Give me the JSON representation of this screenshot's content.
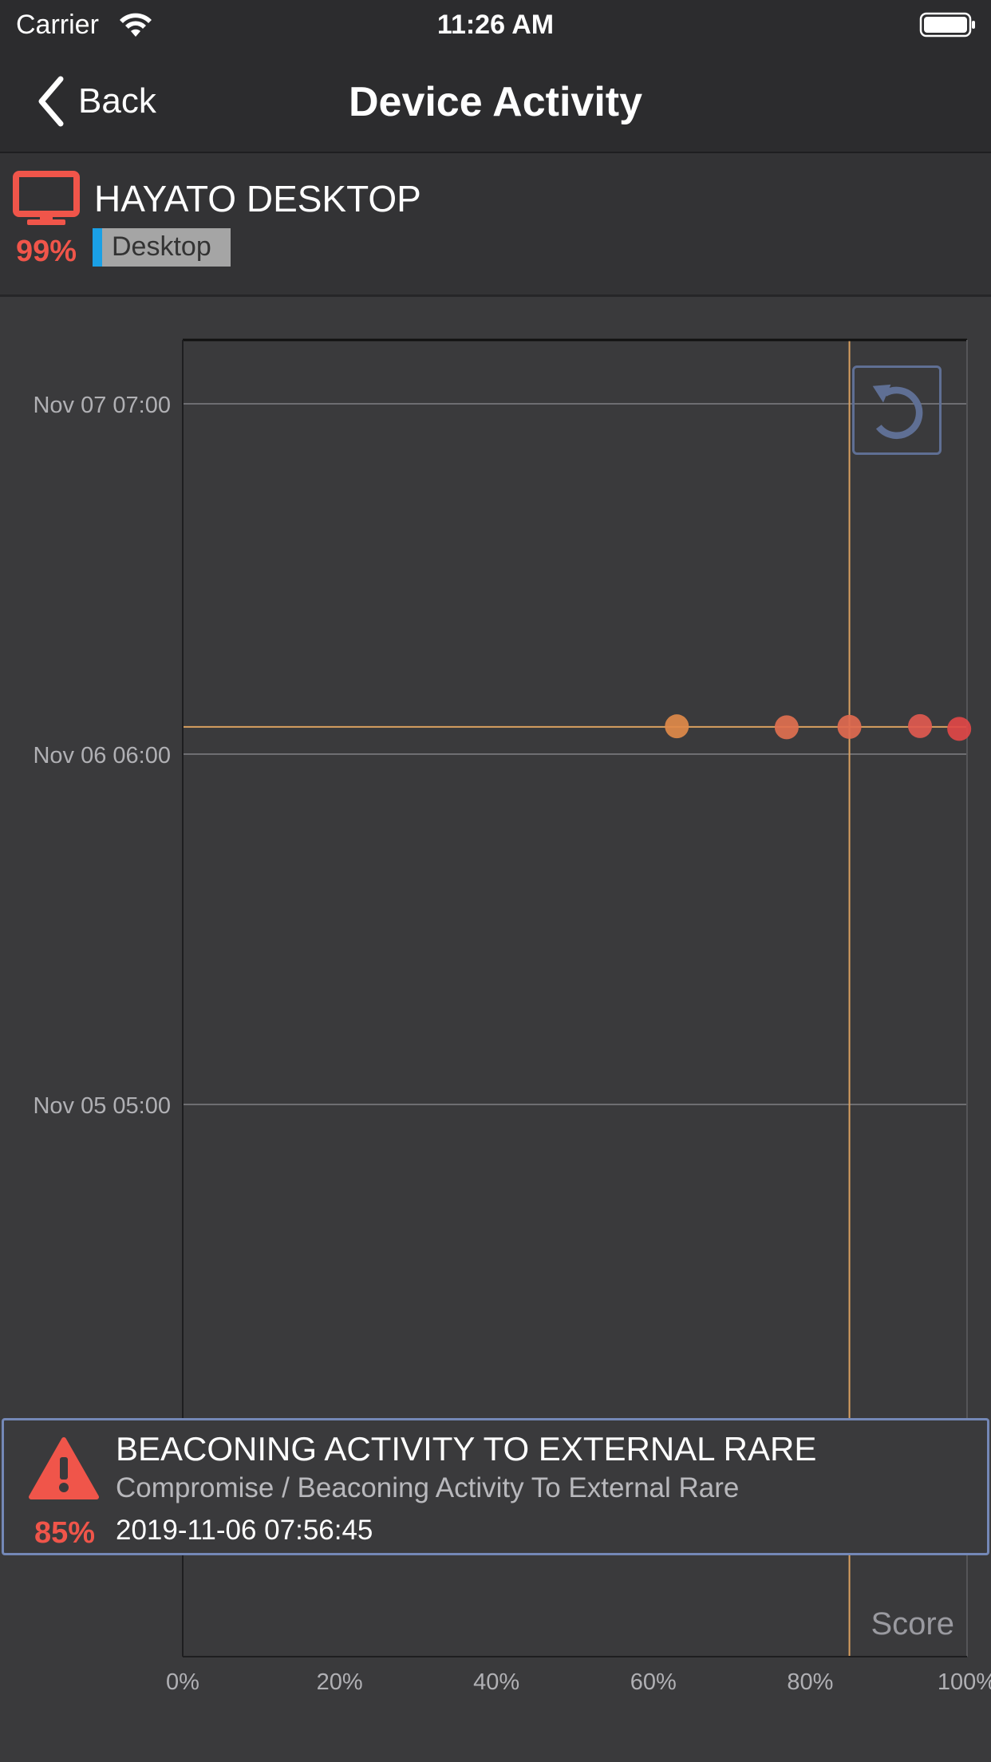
{
  "status_bar": {
    "carrier": "Carrier",
    "time": "11:26 AM"
  },
  "nav": {
    "back_label": "Back",
    "title": "Device Activity"
  },
  "device": {
    "name": "HAYATO DESKTOP",
    "score": "99%",
    "type_tag": "Desktop",
    "icon": "desktop-monitor-icon",
    "icon_color": "#f0554a",
    "tag_accent": "#1aa0e6"
  },
  "chart_data": {
    "type": "scatter",
    "xlabel": "Score",
    "x_ticks": [
      "0%",
      "20%",
      "40%",
      "60%",
      "80%",
      "100%"
    ],
    "xlim": [
      0,
      100
    ],
    "y_ticks": [
      "Nov 07 07:00",
      "Nov 06 06:00",
      "Nov 05 05:00"
    ],
    "y_axis": "time (descending)",
    "grid": true,
    "crosshair": {
      "x": 85,
      "y": "2019-11-06 07:56:45"
    },
    "points": [
      {
        "score": 63,
        "time": "2019-11-06 07:59",
        "color": "#e08a4a"
      },
      {
        "score": 77,
        "time": "2019-11-06 07:55",
        "color": "#e07050"
      },
      {
        "score": 85,
        "time": "2019-11-06 07:56:45",
        "color": "#e06a50"
      },
      {
        "score": 94,
        "time": "2019-11-06 08:00",
        "color": "#e05a50"
      },
      {
        "score": 99,
        "time": "2019-11-06 07:48",
        "color": "#e04848"
      }
    ],
    "colors": {
      "crosshair": "#d9a060",
      "grid": "#6e6e72",
      "axis": "#111111"
    }
  },
  "controls": {
    "reset_icon": "reset-zoom-icon"
  },
  "alert": {
    "title": "BEACONING ACTIVITY TO EXTERNAL RARE",
    "subtitle": "Compromise / Beaconing Activity To External Rare",
    "time": "2019-11-06 07:56:45",
    "score": "85%",
    "icon": "warning-triangle-icon",
    "color": "#f0554a"
  }
}
